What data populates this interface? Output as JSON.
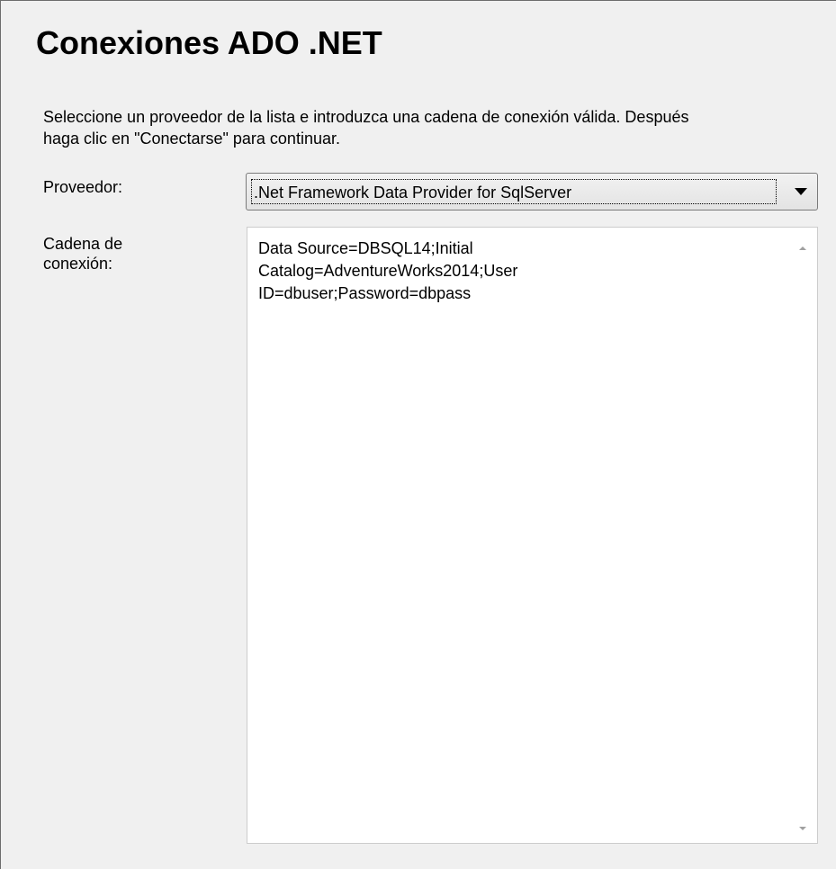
{
  "page": {
    "title": "Conexiones ADO .NET",
    "description_lines": [
      "Seleccione un proveedor de la lista e introduzca una cadena de conexión válida. Después",
      "haga clic en \"Conectarse\" para continuar."
    ]
  },
  "provider": {
    "label": "Proveedor:",
    "selected": ".Net Framework Data Provider for SqlServer",
    "arrow_icon": "chevron-down-icon"
  },
  "connection_string": {
    "label_lines": [
      "Cadena de",
      "conexión:"
    ],
    "value_lines": [
      "Data Source=DBSQL14;Initial",
      "Catalog=AdventureWorks2014;User",
      "ID=dbuser;Password=dbpass"
    ]
  },
  "colors": {
    "panel_background": "#f0f0f0",
    "field_background": "#ffffff",
    "border": "#7a7a7a"
  }
}
